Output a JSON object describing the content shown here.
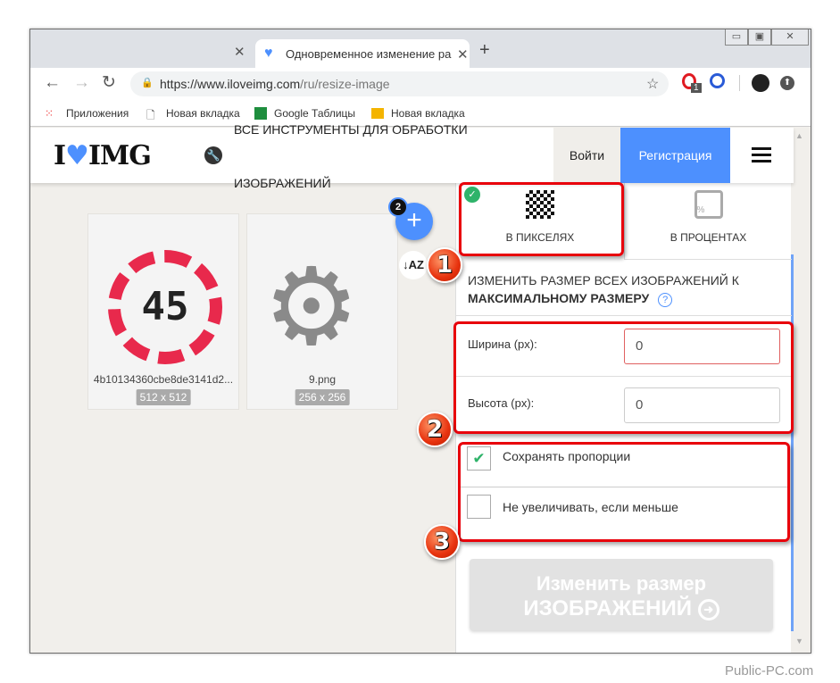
{
  "browser": {
    "active_tab_title": "Одновременное изменение ра",
    "url_host": "https://www.iloveimg.com",
    "url_path": "/ru/resize-image",
    "extension_badge": "1",
    "bookmarks": [
      "Приложения",
      "Новая вкладка",
      "Google Таблицы",
      "Новая вкладка"
    ]
  },
  "header": {
    "logo_left": "I",
    "logo_right": "IMG",
    "nav_line1": "ВСЕ ИНСТРУМЕНТЫ ДЛЯ ОБРАБОТКИ",
    "nav_line2": "ИЗОБРАЖЕНИЙ",
    "login": "Войти",
    "register": "Регистрация",
    "brand_color": "#4d90fe"
  },
  "files": {
    "count_badge": "2",
    "items": [
      {
        "name": "4b10134360cbe8de3141d2...",
        "dims": "512 x 512",
        "preview_text": "45"
      },
      {
        "name": "9.png",
        "dims": "256 x 256"
      }
    ]
  },
  "panel": {
    "tabs": [
      {
        "label": "В ПИКСЕЛЯХ",
        "selected": true
      },
      {
        "label": "В ПРОЦЕНТАХ",
        "selected": false
      }
    ],
    "heading_line1": "ИЗМЕНИТЬ РАЗМЕР ВСЕХ ИЗОБРАЖЕНИЙ К",
    "heading_line2": "МАКСИМАЛЬНОМУ РАЗМЕРУ",
    "width_label": "Ширина (px):",
    "width_value": "0",
    "height_label": "Высота (px):",
    "height_value": "0",
    "keep_ratio": {
      "label": "Сохранять пропорции",
      "checked": true
    },
    "no_enlarge": {
      "label": "Не увеличивать, если меньше",
      "checked": false
    },
    "submit_line1": "Изменить размер",
    "submit_line2": "ИЗОБРАЖЕНИЙ"
  },
  "annotations": [
    "1",
    "2",
    "3"
  ],
  "watermark": "Public-PC.com"
}
